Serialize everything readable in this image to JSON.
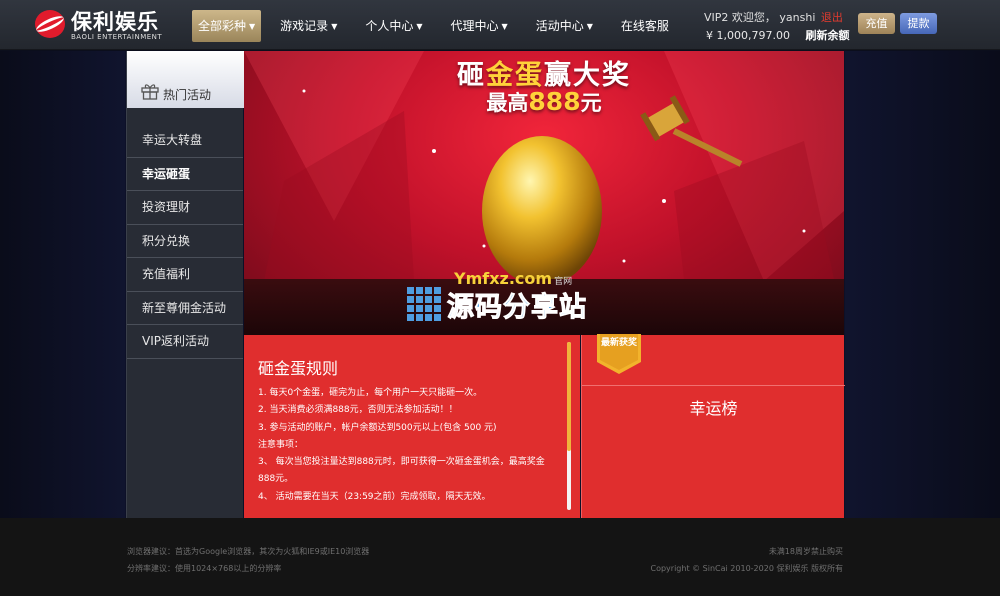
{
  "header": {
    "logo_name": "保利娱乐",
    "logo_sub": "BAOLI ENTERTAINMENT",
    "nav": [
      {
        "label": "全部彩种",
        "caret": true,
        "active": true
      },
      {
        "label": "游戏记录",
        "caret": true
      },
      {
        "label": "个人中心",
        "caret": true
      },
      {
        "label": "代理中心",
        "caret": true
      },
      {
        "label": "活动中心",
        "caret": true
      },
      {
        "label": "在线客服",
        "caret": false
      }
    ],
    "user": {
      "vip": "VIP2",
      "welcome": "欢迎您，",
      "username": "yanshi",
      "logout": "退出",
      "balance": "¥ 1,000,797.00",
      "refresh": "刷新余额"
    },
    "recharge_label": "充值",
    "withdraw_label": "提款"
  },
  "sidebar": {
    "title": "热门活动",
    "items": [
      {
        "label": "幸运大转盘"
      },
      {
        "label": "幸运砸蛋",
        "active": true
      },
      {
        "label": "投资理财"
      },
      {
        "label": "积分兑换"
      },
      {
        "label": "充值福利"
      },
      {
        "label": "新至尊佣金活动"
      },
      {
        "label": "VIP返利活动"
      }
    ]
  },
  "banner": {
    "title_a": "砸",
    "title_gold": "金蛋",
    "title_b": "赢大奖",
    "sub_a": "最高",
    "sub_num": "888",
    "sub_b": "元",
    "watermark_url": "Ymfxz.com",
    "watermark_small": "官网",
    "watermark_main": "源码分享站"
  },
  "rules": {
    "title": "砸金蛋规则",
    "lines": [
      "1. 每天0个金蛋，砸完为止，每个用户一天只能砸一次。",
      "2. 当天消费必须满888元，否则无法参加活动！！",
      "3. 参与活动的账户，帐户余额达到500元以上(包含 500 元)",
      "注意事项：",
      "3、 每次当您投注量达到888元时，即可获得一次砸金蛋机会，最高奖金",
      "888元。",
      "4、 活动需要在当天（23:59之前）完成领取，隔天无效。"
    ],
    "scroll_fraction": 0.65
  },
  "board": {
    "ribbon": "最新获奖",
    "title": "幸运榜"
  },
  "footer": {
    "left1": "浏览器建议：首选为Google浏览器，其次为火狐和IE9或IE10浏览器",
    "left2": "分辨率建议：使用1024×768以上的分辨率",
    "right1": "未满18周岁禁止购买",
    "right2": "Copyright © SinCai 2010-2020 保利娱乐 版权所有"
  },
  "colors": {
    "accent_gold": "#ffd23a",
    "panel_red": "#e02e2e",
    "logout_red": "#e23b2f"
  }
}
